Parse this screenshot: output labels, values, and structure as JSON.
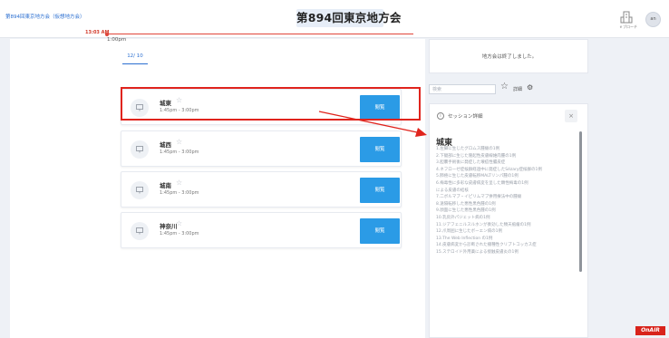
{
  "header": {
    "subtitle": "第894回東京地方会（仮想地方会）",
    "title": "第894回東京地方会",
    "ebook_label": "ｅブローチ",
    "avatar_text": "an"
  },
  "schedule": {
    "date_tab": "12/ 10",
    "now_time": "13:03 AM",
    "time_label": "1:00pm",
    "sessions": [
      {
        "name": "城東",
        "time": "1:45pm - 3:00pm",
        "button": "閲覧"
      },
      {
        "name": "城西",
        "time": "1:45pm - 3:00pm",
        "button": "閲覧"
      },
      {
        "name": "城南",
        "time": "1:45pm - 3:00pm",
        "button": "閲覧"
      },
      {
        "name": "神奈川",
        "time": "1:45pm - 3:00pm",
        "button": "閲覧"
      }
    ]
  },
  "right": {
    "notice": "地方会は終了しました。",
    "search_placeholder": "検索",
    "detail_label": "詳細",
    "detail": {
      "title": "セッション詳細",
      "close": "×",
      "session_name": "城東",
      "lectures": [
        "1.左脚に生じたグロムス腫瘍の1例",
        "2.下腿部に生じた隆起性皮膚線維肉腫の1例",
        "3.胆嚢手術後に発症した壊疽性膿皮症",
        "4.ネフローゼ症候群経過中に発症したSézary症候群の1例",
        "5.肺癌に生じた皮膚転移MALTリンパ腫の1例",
        "6.梅毒性に多彩な皮膚病変を呈した顕性梅毒の1例",
        "による皮膚の結核",
        "7.二ボルマブ・イピリムマブ併用療法中の腫瘍",
        "8.遠隔転移した悪性黒色腫の1例",
        "9.顔面に生じた悪性黒色腫の1例",
        "10.乳房外パジェット病の1例",
        "11.ジアフェニルスルホンが奏効した類天疱瘡の1例",
        "12.爪周囲に生じたボーエン病の1例",
        "13.The Web Inflection の1例",
        "14.皮膚病変から診断された播種性クリプトコッカス症",
        "15.ステロイド外用薬による接触皮膚炎の1例"
      ]
    }
  },
  "onair": "OnAIR"
}
